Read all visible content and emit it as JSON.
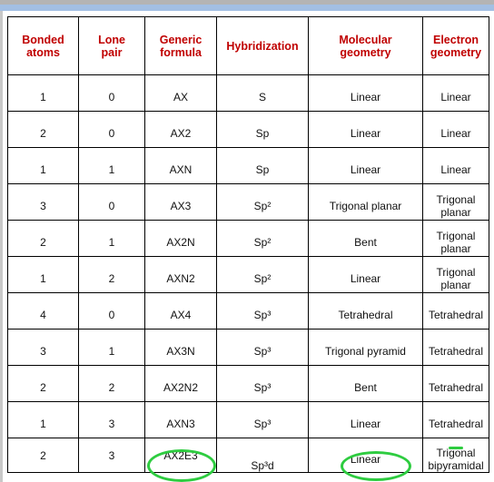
{
  "headers": [
    [
      "Bonded",
      "atoms"
    ],
    [
      "Lone",
      "pair"
    ],
    [
      "Generic",
      "formula"
    ],
    [
      "Hybridization",
      ""
    ],
    [
      "Molecular",
      "geometry"
    ],
    [
      "Electron",
      "geometry"
    ]
  ],
  "rows": [
    [
      "1",
      "0",
      "AX",
      "S",
      "Linear",
      "Linear"
    ],
    [
      "2",
      "0",
      "AX2",
      "Sp",
      "Linear",
      "Linear"
    ],
    [
      "1",
      "1",
      "AXN",
      "Sp",
      "Linear",
      "Linear"
    ],
    [
      "3",
      "0",
      "AX3",
      "Sp²",
      "Trigonal planar",
      "Trigonal planar"
    ],
    [
      "2",
      "1",
      "AX2N",
      "Sp²",
      "Bent",
      "Trigonal planar"
    ],
    [
      "1",
      "2",
      "AXN2",
      "Sp²",
      "Linear",
      "Trigonal planar"
    ],
    [
      "4",
      "0",
      "AX4",
      "Sp³",
      "Tetrahedral",
      "Tetrahedral"
    ],
    [
      "3",
      "1",
      "AX3N",
      "Sp³",
      "Trigonal pyramid",
      "Tetrahedral"
    ],
    [
      "2",
      "2",
      "AX2N2",
      "Sp³",
      "Bent",
      "Tetrahedral"
    ],
    [
      "1",
      "3",
      "AXN3",
      "Sp³",
      "Linear",
      "Tetrahedral"
    ],
    [
      "2",
      "3",
      "AX2E3",
      "Sp³d",
      "Linear",
      "Trigonal bipyramidal"
    ]
  ],
  "colors": {
    "header_text": "#c00000",
    "annotation": "#2ecc40"
  }
}
